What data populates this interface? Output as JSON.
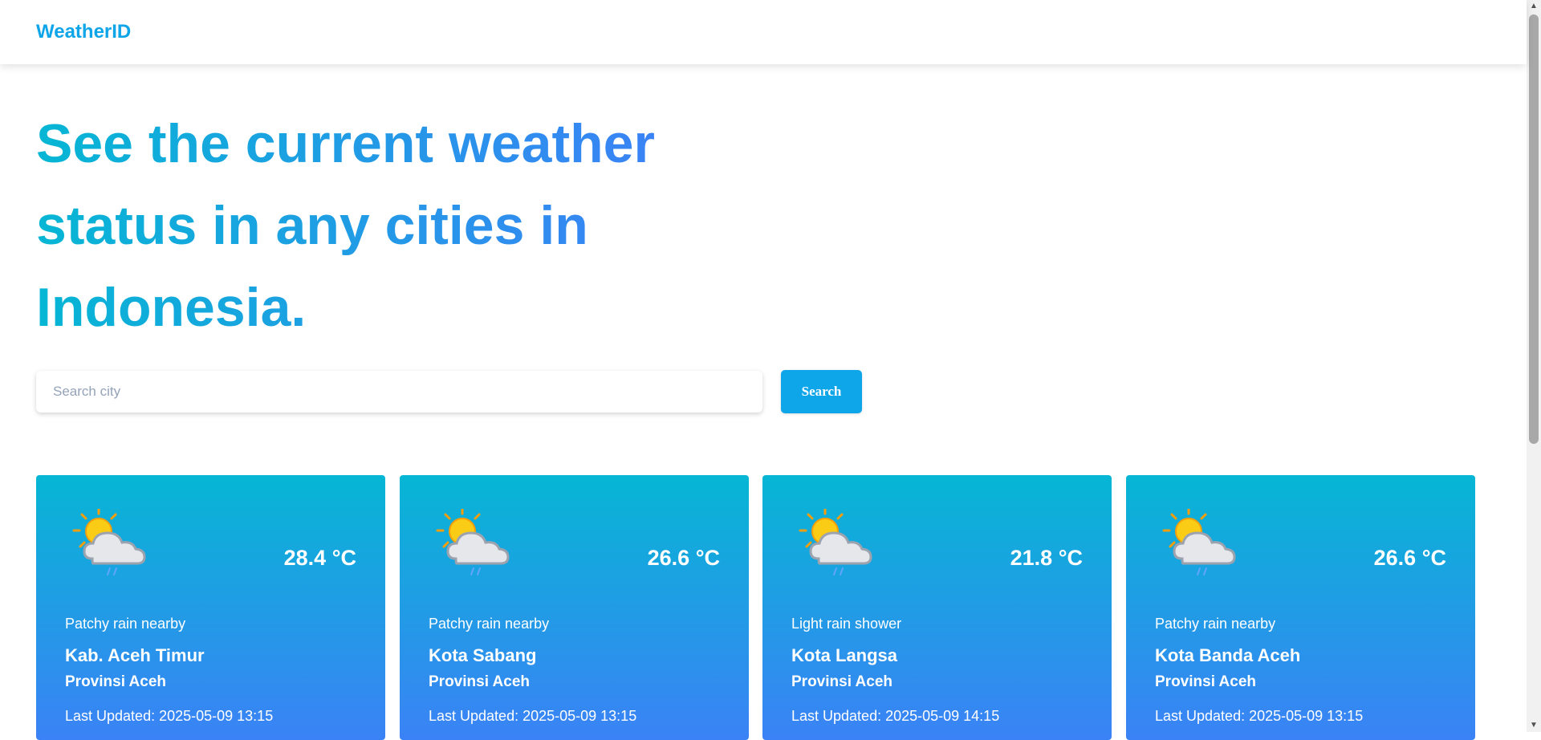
{
  "header": {
    "brand": "WeatherID"
  },
  "hero": {
    "title_line1": "See the current weather",
    "title_line2": "status in any cities in",
    "title_line3": "Indonesia."
  },
  "search": {
    "placeholder": "Search city",
    "value": "",
    "button_label": "Search"
  },
  "cards": [
    {
      "icon": "partly-cloudy-rain-icon",
      "temperature": "28.4 °C",
      "condition": "Patchy rain nearby",
      "city": "Kab. Aceh Timur",
      "province": "Provinsi Aceh",
      "last_updated": "Last Updated: 2025-05-09 13:15"
    },
    {
      "icon": "partly-cloudy-rain-icon",
      "temperature": "26.6 °C",
      "condition": "Patchy rain nearby",
      "city": "Kota Sabang",
      "province": "Provinsi Aceh",
      "last_updated": "Last Updated: 2025-05-09 13:15"
    },
    {
      "icon": "partly-cloudy-rain-icon",
      "temperature": "21.8 °C",
      "condition": "Light rain shower",
      "city": "Kota Langsa",
      "province": "Provinsi Aceh",
      "last_updated": "Last Updated: 2025-05-09 14:15"
    },
    {
      "icon": "partly-cloudy-rain-icon",
      "temperature": "26.6 °C",
      "condition": "Patchy rain nearby",
      "city": "Kota Banda Aceh",
      "province": "Provinsi Aceh",
      "last_updated": "Last Updated: 2025-05-09 13:15"
    }
  ],
  "colors": {
    "brand": "#0ea5e9",
    "card_gradient_top": "#06b6d4",
    "card_gradient_bottom": "#3b82f6",
    "button": "#0ea5e9"
  }
}
